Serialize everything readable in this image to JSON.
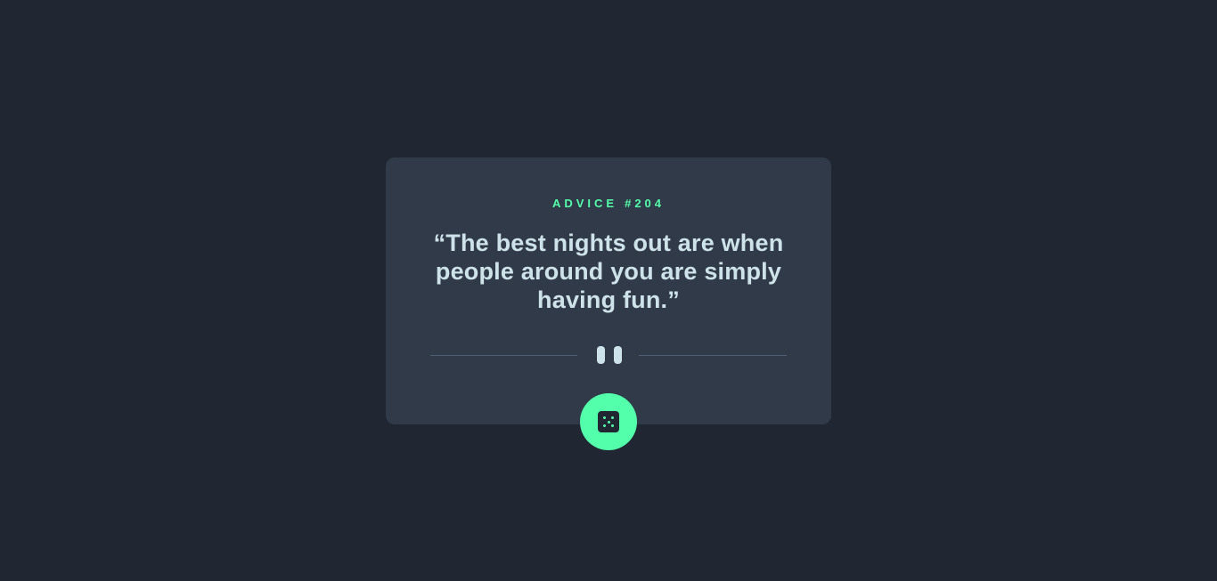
{
  "card": {
    "advice_label": "Advice",
    "advice_number": "#204",
    "quote": "“The best nights out are when people around you are simply having fun.”"
  },
  "divider": {
    "icon": "pause-icon"
  },
  "dice_button": {
    "icon": "dice-icon"
  },
  "colors": {
    "background": "#202632",
    "card": "#313a48",
    "accent": "#53ffaa",
    "text": "#cee3e9",
    "divider_line": "#4f5d74"
  }
}
